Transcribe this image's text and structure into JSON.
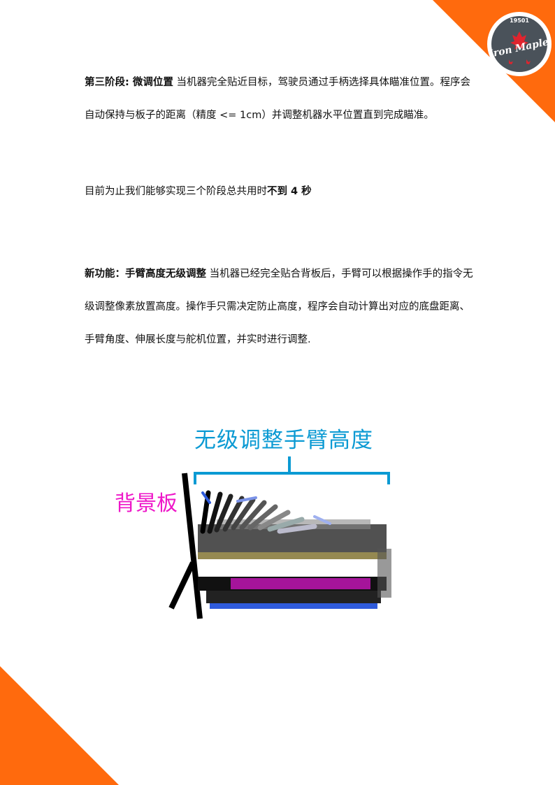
{
  "logo": {
    "year": "19501",
    "name": "Iron Maple"
  },
  "section1": {
    "heading": "第三阶段: 微调位置",
    "body": "当机器完全贴近目标，驾驶员通过手柄选择具体瞄准位置。程序会自动保持与板子的距离（精度 <= 1cm）并调整机器水平位置直到完成瞄准。"
  },
  "summary": {
    "prefix": "目前为止我们能够实现三个阶段总共用时",
    "emphasis": "不到 4 秒"
  },
  "section2": {
    "heading": "新功能：手臂高度无级调整",
    "body": "当机器已经完全贴合背板后，手臂可以根据操作手的指令无级调整像素放置高度。操作手只需决定防止高度，程序会自动计算出对应的底盘距离、手臂角度、伸展长度与舵机位置，并实时进行调整."
  },
  "diagram": {
    "title": "无级调整手臂高度",
    "backboard_label": "背景板"
  },
  "colors": {
    "accent": "#ff6a0d",
    "title_blue": "#0b9ad3",
    "label_magenta": "#ee16c8"
  }
}
